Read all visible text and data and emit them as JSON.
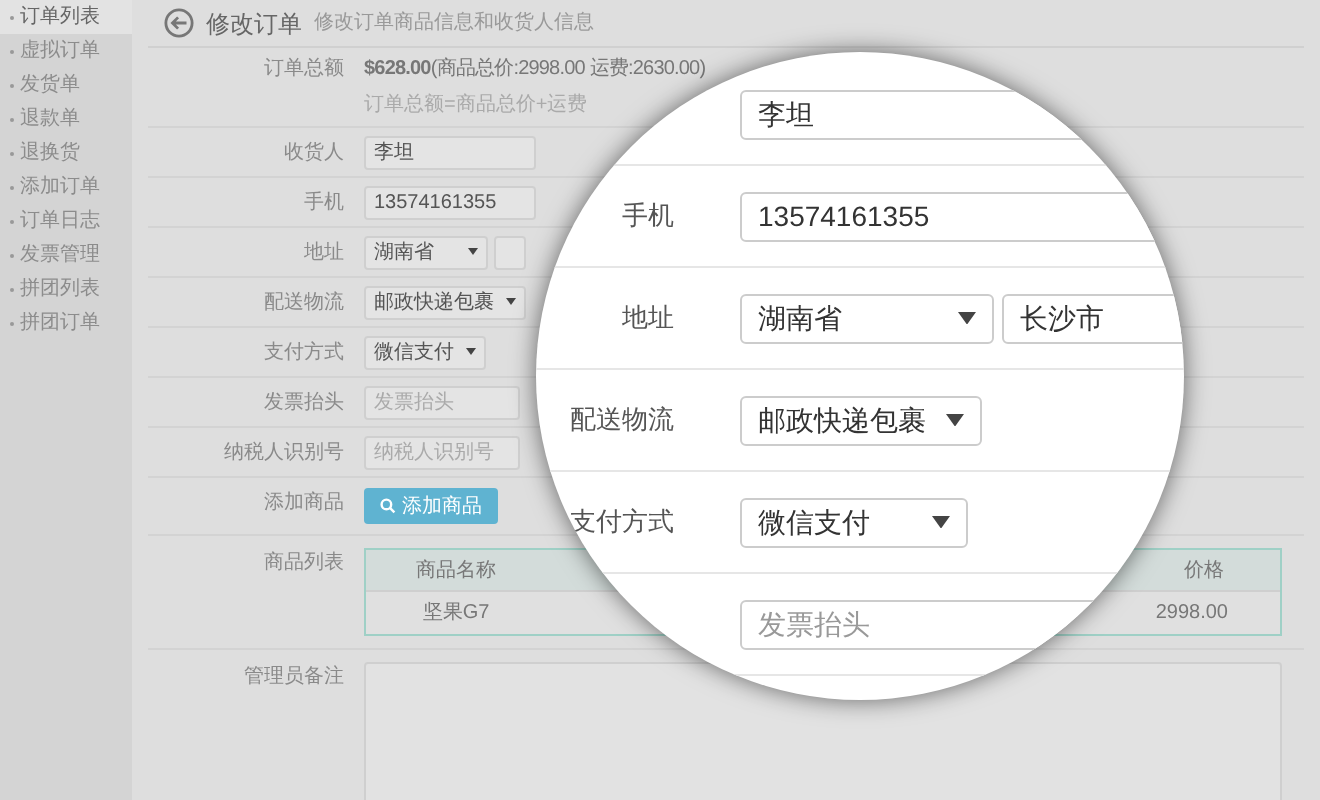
{
  "sidebar": {
    "items": [
      {
        "label": "订单列表",
        "selected": true
      },
      {
        "label": "虚拟订单",
        "selected": false
      },
      {
        "label": "发货单",
        "selected": false
      },
      {
        "label": "退款单",
        "selected": false
      },
      {
        "label": "退换货",
        "selected": false
      },
      {
        "label": "添加订单",
        "selected": false
      },
      {
        "label": "订单日志",
        "selected": false
      },
      {
        "label": "发票管理",
        "selected": false
      },
      {
        "label": "拼团列表",
        "selected": false
      },
      {
        "label": "拼团订单",
        "selected": false
      }
    ]
  },
  "header": {
    "title": "修改订单",
    "subtitle": "修改订单商品信息和收货人信息"
  },
  "form": {
    "rows": [
      {
        "kind": "total",
        "label": "订单总额",
        "value": "**$628.00**(商品总价:2998.00 运费:2630.00)",
        "note": "订单总额=商品总价+运费"
      },
      {
        "kind": "text",
        "label": "收货人",
        "value": "李坦"
      },
      {
        "kind": "text",
        "label": "手机",
        "value": "13574161355"
      },
      {
        "kind": "address",
        "label": "地址",
        "province": "湖南省"
      },
      {
        "kind": "select",
        "label": "配送物流",
        "value": "邮政快递包裹"
      },
      {
        "kind": "select",
        "label": "支付方式",
        "value": "微信支付"
      },
      {
        "kind": "text",
        "label": "发票抬头",
        "placeholder": "发票抬头"
      },
      {
        "kind": "text",
        "label": "纳税人识别号",
        "placeholder": "纳税人识别号"
      },
      {
        "kind": "button",
        "label": "添加商品",
        "button": "添加商品"
      },
      {
        "kind": "table",
        "label": "商品列表",
        "columns": [
          "商品名称",
          "价格"
        ],
        "rows": [
          [
            "坚果G7",
            "2998.00"
          ]
        ]
      },
      {
        "kind": "textarea",
        "label": "管理员备注"
      }
    ]
  },
  "magnifier": {
    "rows": [
      {
        "kind": "text",
        "value": "李坦"
      },
      {
        "kind": "text",
        "label": "手机",
        "value": "13574161355"
      },
      {
        "kind": "address",
        "label": "地址",
        "province": "湖南省",
        "city": "长沙市"
      },
      {
        "kind": "select",
        "label": "配送物流",
        "value": "邮政快递包裹"
      },
      {
        "kind": "select",
        "label": "支付方式",
        "value": "微信支付"
      },
      {
        "kind": "text",
        "placeholder": "发票抬头"
      }
    ]
  }
}
